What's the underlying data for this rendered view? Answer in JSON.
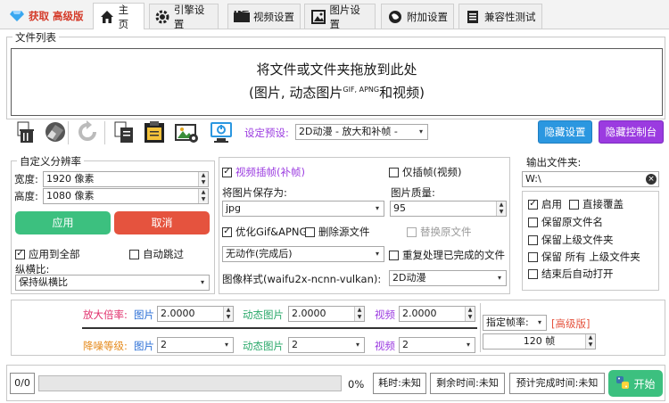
{
  "tabs": {
    "get_label": "获取  高级版",
    "home": "主页",
    "engine": "引擎设置",
    "video": "视频设置",
    "image": "图片设置",
    "extra": "附加设置",
    "compat": "兼容性测试"
  },
  "file_list": {
    "legend": "文件列表",
    "drop_line1": "将文件或文件夹拖放到此处",
    "drop_line2_a": "(图片, 动态图片",
    "drop_line2_sup": "GIF, APNG",
    "drop_line2_b": "和视频)"
  },
  "toolbar": {
    "preset_label": "设定预设:",
    "preset_value": "2D动漫 - 放大和补帧 -",
    "hide_settings": "隐藏设置",
    "hide_console": "隐藏控制台",
    "icons": [
      "trash-icon",
      "eraser-icon",
      "refresh-icon",
      "copy-icon",
      "paste-icon",
      "image-settings-icon",
      "monitor-icon"
    ]
  },
  "resolution": {
    "legend": "自定义分辨率",
    "width_label": "宽度:",
    "width_value": "1920 像素",
    "height_label": "高度:",
    "height_value": "1080 像素",
    "apply": "应用",
    "cancel": "取消",
    "apply_all": "应用到全部",
    "apply_all_checked": true,
    "auto_skip": "自动跳过",
    "aspect_label": "纵横比:",
    "aspect_value": "保持纵横比"
  },
  "middle": {
    "video_interp": "视频插帧(补帧)",
    "video_interp_checked": true,
    "interp_only": "仅插帧(视频)",
    "save_as_label": "将图片保存为:",
    "save_as_value": "jpg",
    "quality_label": "图片质量:",
    "quality_value": "95",
    "optimize_gif": "优化Gif&APNG",
    "optimize_gif_checked": true,
    "delete_source": "删除源文件",
    "replace_source": "替换原文件",
    "action_value": "无动作(完成后)",
    "reprocess": "重复处理已完成的文件",
    "style_label": "图像样式(waifu2x-ncnn-vulkan):",
    "style_value": "2D动漫"
  },
  "output": {
    "legend": "输出文件夹:",
    "path": "W:\\",
    "enable": "启用",
    "enable_checked": true,
    "direct_overwrite": "直接覆盖",
    "keep_name": "保留原文件名",
    "keep_parent": "保留上级文件夹",
    "keep_all_a": "保留  所有  上级文件夹",
    "open_after": "结束后自动打开"
  },
  "scale": {
    "scale_label": "放大倍率:",
    "denoise_label": "降噪等级:",
    "image": "图片",
    "anim": "动态图片",
    "video": "视频",
    "scale_image": "2.0000",
    "scale_anim": "2.0000",
    "scale_video": "2.0000",
    "denoise_image": "2",
    "denoise_anim": "2",
    "denoise_video": "2",
    "fps_mode": "指定帧率:",
    "fps_pro": "[高级版]",
    "fps_value": "120 帧"
  },
  "status": {
    "count": "0/0",
    "progress_pct": "0%",
    "progress": 0,
    "elapsed": "耗时:未知",
    "remaining": "剩余时间:未知",
    "eta": "预计完成时间:未知",
    "start": "开始"
  },
  "colors": {
    "scale_label": "#e0306c",
    "denoise_label": "#e58a1c",
    "image_label": "#2b6fd6",
    "anim_label": "#2aa86a",
    "video_label": "#9b3be0",
    "preset_label": "#9b3be0",
    "pro_label": "#e5533e"
  }
}
